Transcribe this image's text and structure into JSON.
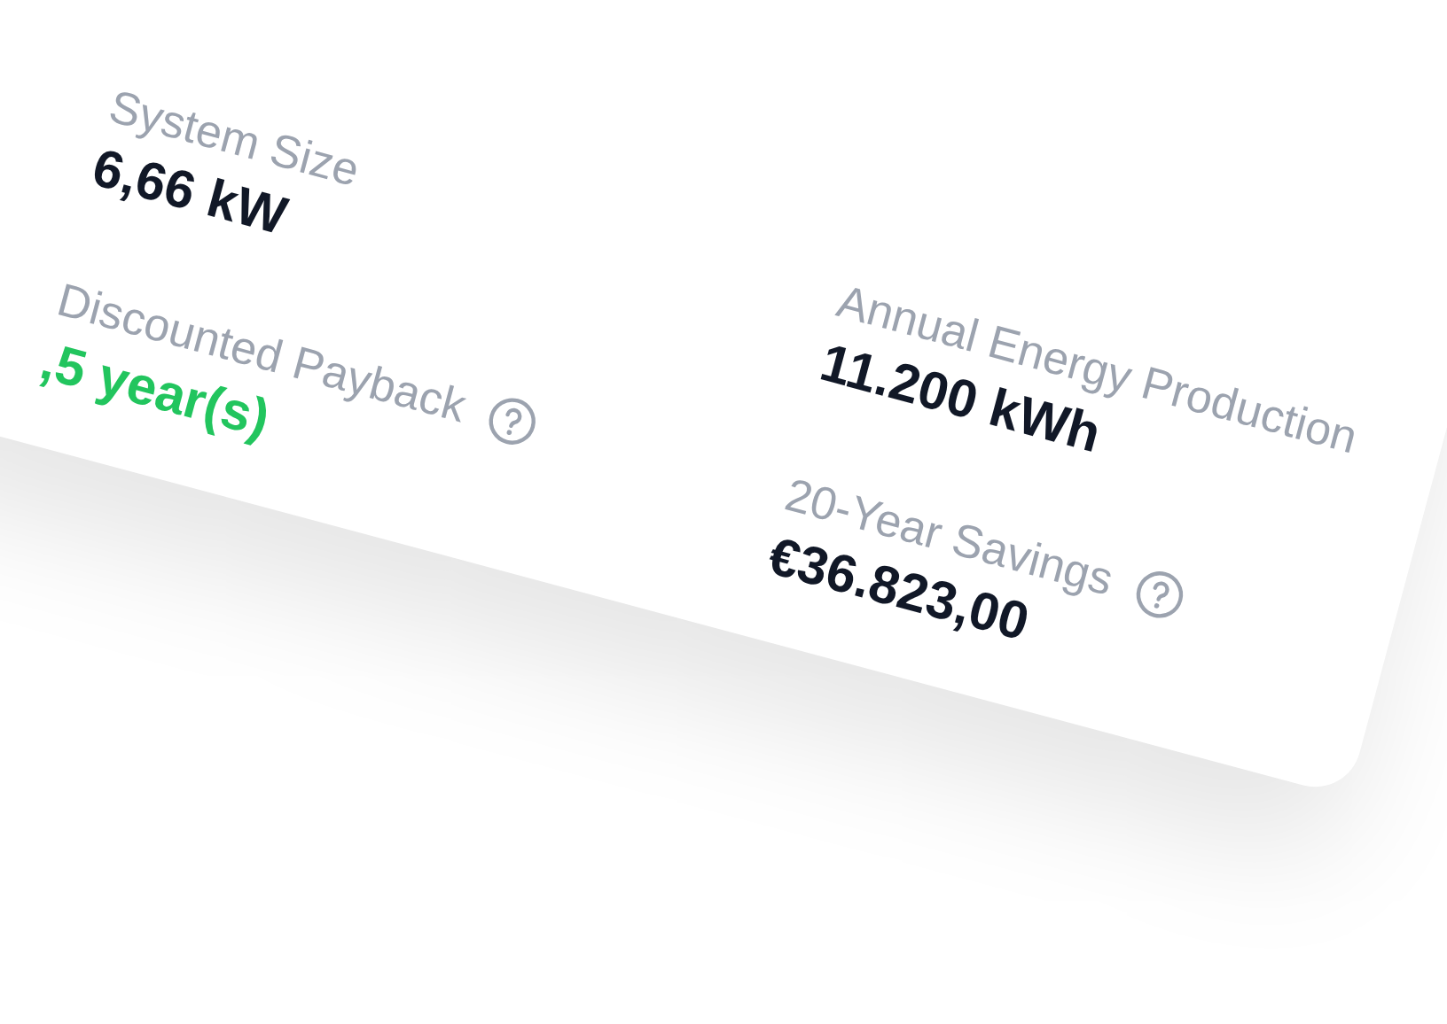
{
  "metrics": [
    {
      "label": "System Size",
      "value": "6,66 kW",
      "help": false,
      "positive": false
    },
    {
      "label": "Annual Energy Production",
      "value": "11.200 kWh",
      "help": false,
      "positive": false
    },
    {
      "label": "Discounted Payback",
      "value": ",5 year(s)",
      "help": true,
      "positive": true
    },
    {
      "label": "20-Year Savings",
      "value": "€36.823,00",
      "help": true,
      "positive": false
    }
  ]
}
